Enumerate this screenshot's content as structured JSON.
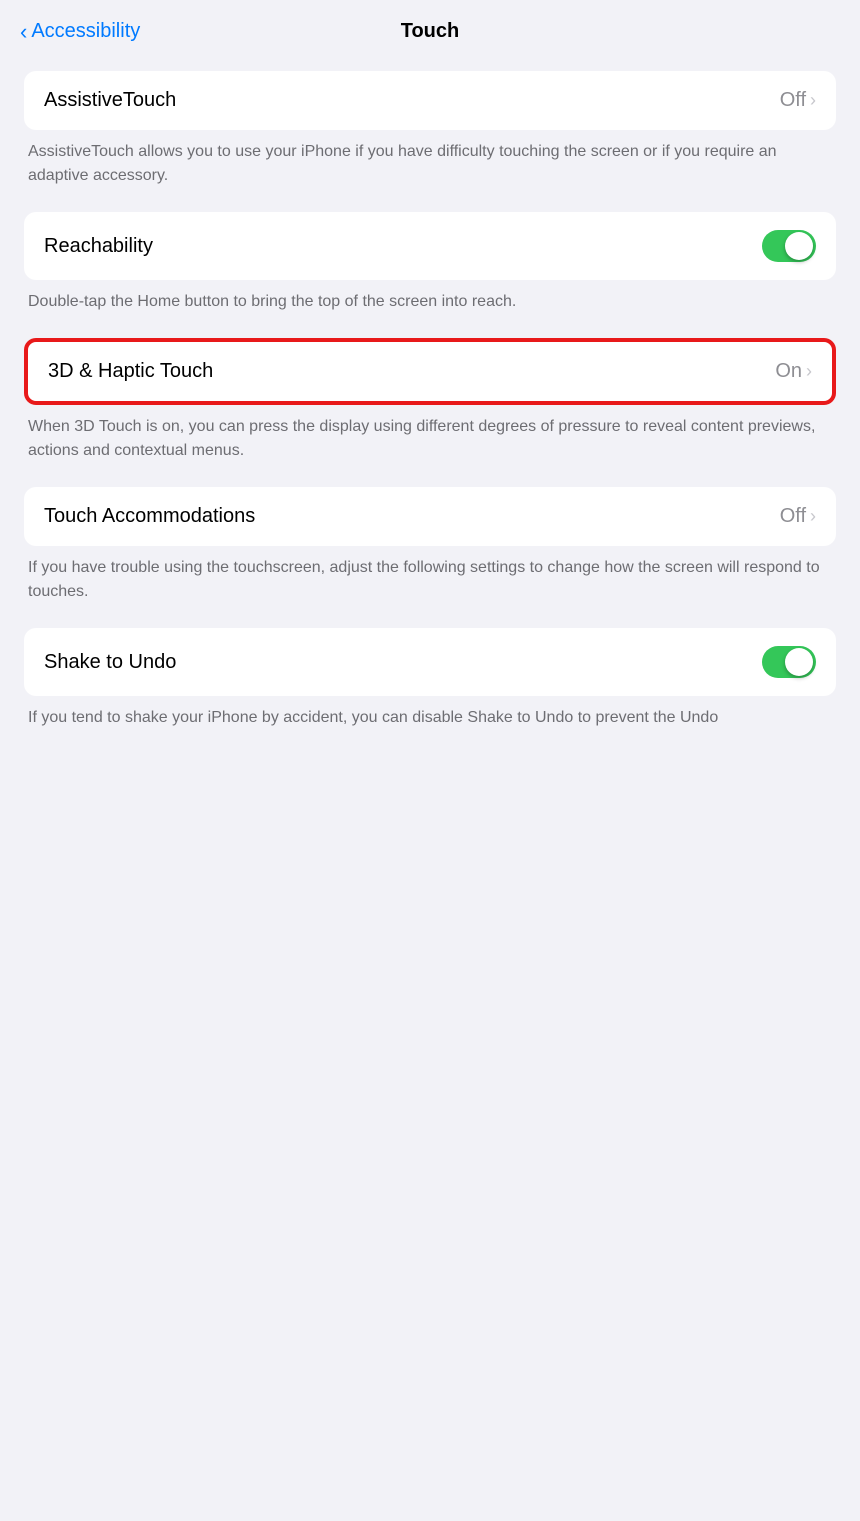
{
  "header": {
    "back_label": "Accessibility",
    "title": "Touch"
  },
  "sections": [
    {
      "id": "assistive-touch",
      "card": {
        "label": "AssistiveTouch",
        "value": "Off",
        "has_chevron": true,
        "type": "navigation"
      },
      "description": "AssistiveTouch allows you to use your iPhone if you have difficulty touching the screen or if you require an adaptive accessory."
    },
    {
      "id": "reachability",
      "card": {
        "label": "Reachability",
        "value": null,
        "has_chevron": false,
        "type": "toggle",
        "toggle_state": "on"
      },
      "description": "Double-tap the Home button to bring the top of the screen into reach."
    },
    {
      "id": "3d-haptic-touch",
      "card": {
        "label": "3D & Haptic Touch",
        "value": "On",
        "has_chevron": true,
        "type": "navigation",
        "highlighted": true
      },
      "description": "When 3D Touch is on, you can press the display using different degrees of pressure to reveal content previews, actions and contextual menus."
    },
    {
      "id": "touch-accommodations",
      "card": {
        "label": "Touch Accommodations",
        "value": "Off",
        "has_chevron": true,
        "type": "navigation"
      },
      "description": "If you have trouble using the touchscreen, adjust the following settings to change how the screen will respond to touches."
    },
    {
      "id": "shake-to-undo",
      "card": {
        "label": "Shake to Undo",
        "value": null,
        "has_chevron": false,
        "type": "toggle",
        "toggle_state": "on"
      },
      "description": "If you tend to shake your iPhone by accident, you can disable Shake to Undo to prevent the Undo"
    }
  ]
}
